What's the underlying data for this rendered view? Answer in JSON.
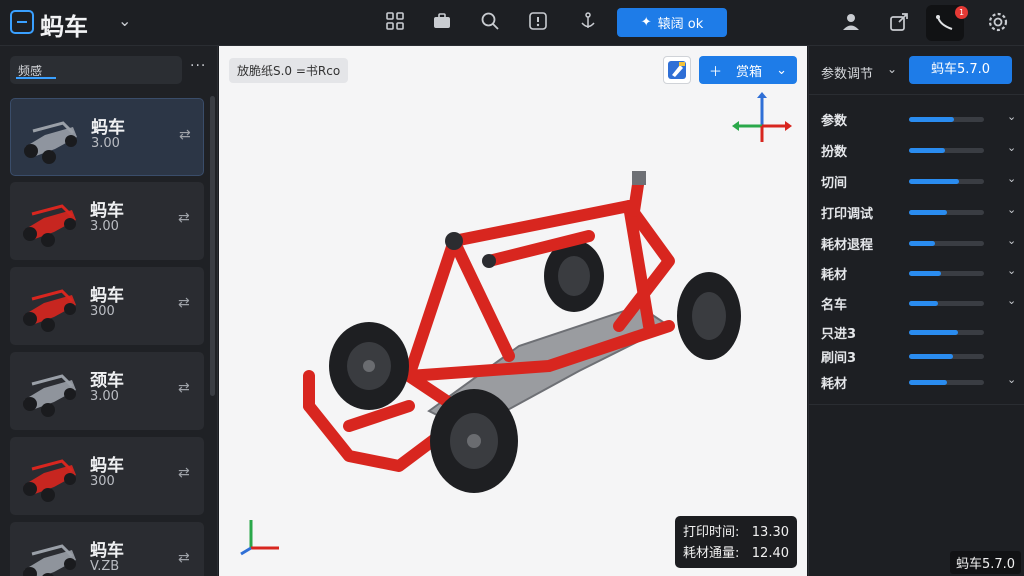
{
  "app": {
    "title": "蚂车"
  },
  "toolbar": {
    "primary_label": "辕阔 ok"
  },
  "notifications": {
    "count": "1"
  },
  "sidebar": {
    "search_value": "频感",
    "items": [
      {
        "name": "蚂车",
        "version": "3.00",
        "color": "#9aa0a8"
      },
      {
        "name": "蚂车",
        "version": "3.00",
        "color": "#d8261f"
      },
      {
        "name": "蚂车",
        "version": "300",
        "color": "#d8261f"
      },
      {
        "name": "颈车",
        "version": "3.00",
        "color": "#9aa0a8"
      },
      {
        "name": "蚂车",
        "version": "300",
        "color": "#d8261f"
      },
      {
        "name": "蚂车",
        "version": "V.ZB",
        "color": "#9aa0a8"
      }
    ]
  },
  "viewport": {
    "label": "放脆纸S.0 =书Rco",
    "add_label": "赏箱",
    "stats": {
      "print_time_label": "打印时间:",
      "print_time_value": "13.30",
      "material_label": "耗材通量:",
      "material_value": "12.40"
    }
  },
  "right_panel": {
    "header": "参数调节",
    "button_label": "蚂车5.7.0",
    "params": [
      {
        "label": "参数",
        "level": 0.6,
        "has_dropdown": true
      },
      {
        "label": "扮数",
        "level": 0.48,
        "has_dropdown": true
      },
      {
        "label": "切间",
        "level": 0.66,
        "has_dropdown": true
      },
      {
        "label": "打印调试",
        "level": 0.5,
        "has_dropdown": true
      },
      {
        "label": "耗材退程",
        "level": 0.35,
        "has_dropdown": true
      },
      {
        "label": "耗材",
        "level": 0.42,
        "has_dropdown": true
      },
      {
        "label": "名车",
        "level": 0.38,
        "has_dropdown": true
      },
      {
        "label": "只进3",
        "level": 0.65,
        "has_dropdown": false
      },
      {
        "label": "刷间3",
        "level": 0.58,
        "has_dropdown": false
      },
      {
        "label": "耗材",
        "level": 0.5,
        "has_dropdown": true
      }
    ]
  },
  "footer": {
    "version": "蚂车5.7.0"
  },
  "colors": {
    "accent": "#1e7ce8",
    "frame_red": "#d8261f"
  }
}
